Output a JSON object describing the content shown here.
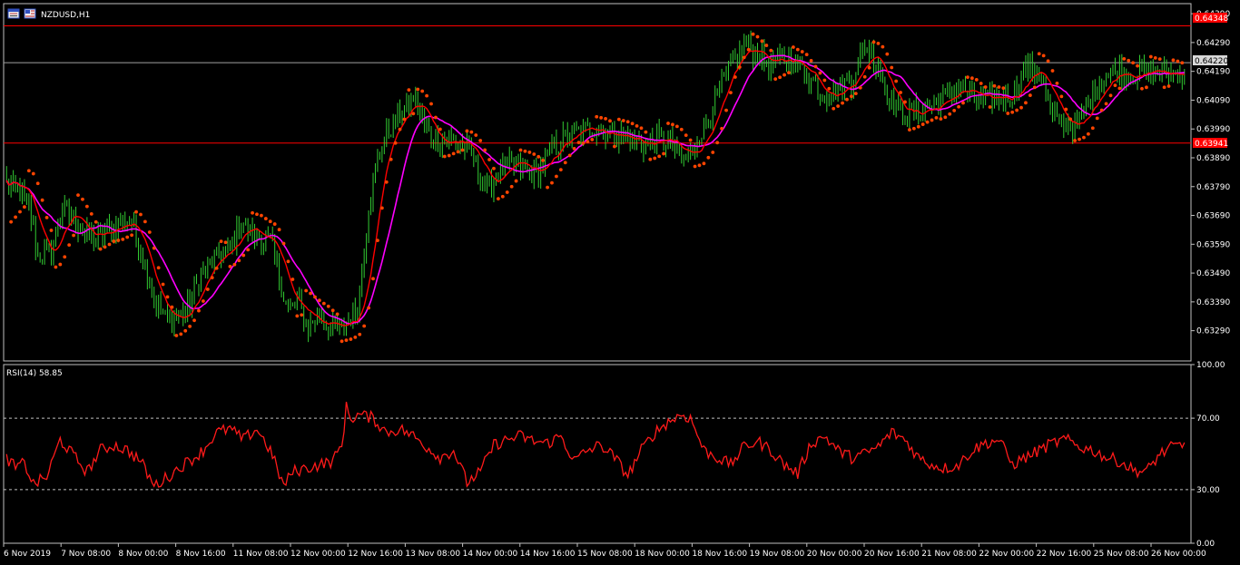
{
  "window": {
    "symbol_title": "NZDUSD,H1"
  },
  "colors": {
    "background": "#000000",
    "frame": "#c0c0c0",
    "candles": "#32cd32",
    "ma_fast": "#ff0000",
    "ma_slow": "#ff00ff",
    "sar": "#ff4500",
    "level_line": "#ff0000",
    "current_price_line": "#a0a0a0",
    "rsi_line": "#ff1a1a",
    "rsi_levels": "#c0c0c0"
  },
  "price_tags": {
    "top_level": "0.64348",
    "current": "0.64220",
    "bottom_level": "0.63941"
  },
  "rsi_panel": {
    "label": "RSI(14) 58.85",
    "levels": [
      "100.00",
      "70.00",
      "30.00",
      "0.00"
    ]
  },
  "chart_data": [
    {
      "type": "candlestick",
      "title": "NZDUSD,H1",
      "y_ticks": [
        "0.64390",
        "0.64290",
        "0.64190",
        "0.64090",
        "0.63990",
        "0.63890",
        "0.63790",
        "0.63690",
        "0.63590",
        "0.63490",
        "0.63390",
        "0.63290"
      ],
      "ylim": [
        0.63185,
        0.64425
      ],
      "x_ticks": [
        "6 Nov 2019",
        "7 Nov 08:00",
        "8 Nov 00:00",
        "8 Nov 16:00",
        "11 Nov 08:00",
        "12 Nov 00:00",
        "12 Nov 16:00",
        "13 Nov 08:00",
        "14 Nov 00:00",
        "14 Nov 16:00",
        "15 Nov 08:00",
        "18 Nov 00:00",
        "18 Nov 16:00",
        "19 Nov 08:00",
        "20 Nov 00:00",
        "20 Nov 16:00",
        "21 Nov 08:00",
        "22 Nov 00:00",
        "22 Nov 16:00",
        "25 Nov 08:00",
        "26 Nov 00:00"
      ],
      "horizontal_levels": [
        0.64348,
        0.63941
      ],
      "current_price": 0.6422,
      "close_path": {
        "x_index": [
          0,
          5,
          10,
          14,
          20,
          25,
          30,
          35,
          40,
          48,
          55,
          60,
          66,
          72,
          80,
          88,
          95,
          100,
          105,
          110,
          118,
          126,
          130,
          135,
          140,
          144,
          150,
          157,
          162,
          168,
          175,
          182,
          190,
          197,
          202,
          208,
          215,
          222,
          228,
          233,
          238,
          244,
          250,
          256,
          262,
          268,
          274,
          280,
          286,
          292,
          298,
          302,
          306,
          312,
          318,
          324,
          330,
          336,
          342,
          348,
          354,
          360,
          366,
          372,
          378,
          384,
          390,
          396,
          402,
          408,
          414,
          420,
          426,
          432,
          438,
          444,
          450,
          456,
          462,
          468,
          474,
          480,
          486,
          492,
          498,
          504,
          510,
          516,
          522,
          527
        ],
        "close": [
          0.638,
          0.6378,
          0.6372,
          0.6355,
          0.6356,
          0.6372,
          0.6368,
          0.6362,
          0.6361,
          0.6365,
          0.6368,
          0.6357,
          0.634,
          0.6332,
          0.6335,
          0.635,
          0.6355,
          0.6357,
          0.6368,
          0.6362,
          0.636,
          0.6335,
          0.634,
          0.633,
          0.6335,
          0.633,
          0.633,
          0.6336,
          0.6372,
          0.6395,
          0.6403,
          0.641,
          0.6395,
          0.6395,
          0.6395,
          0.639,
          0.6378,
          0.6386,
          0.6386,
          0.6384,
          0.6384,
          0.6392,
          0.6396,
          0.6398,
          0.64,
          0.6398,
          0.6397,
          0.6395,
          0.6393,
          0.6396,
          0.6393,
          0.6388,
          0.639,
          0.64,
          0.641,
          0.6421,
          0.6428,
          0.6425,
          0.6421,
          0.6423,
          0.6422,
          0.6416,
          0.6411,
          0.6413,
          0.6416,
          0.6428,
          0.6421,
          0.6408,
          0.6404,
          0.6405,
          0.6407,
          0.6409,
          0.6414,
          0.641,
          0.6408,
          0.641,
          0.6411,
          0.642,
          0.6419,
          0.6403,
          0.6401,
          0.64,
          0.6412,
          0.6418,
          0.6419,
          0.6418,
          0.6419,
          0.6418,
          0.6418,
          0.6419
        ]
      }
    },
    {
      "type": "line",
      "title": "RSI(14) 58.85",
      "ylim": [
        0,
        100
      ],
      "y_ticks": [
        "100.00",
        "70.00",
        "30.00",
        "0.00"
      ],
      "levels": [
        70,
        30
      ],
      "series": [
        {
          "name": "RSI(14)",
          "x_index": [
            0,
            4,
            8,
            12,
            18,
            24,
            30,
            36,
            42,
            48,
            54,
            60,
            66,
            72,
            78,
            84,
            88,
            94,
            100,
            106,
            112,
            118,
            124,
            128,
            134,
            140,
            146,
            150,
            152,
            154,
            158,
            164,
            170,
            176,
            182,
            188,
            194,
            200,
            206,
            212,
            218,
            224,
            230,
            236,
            242,
            248,
            254,
            260,
            266,
            272,
            278,
            284,
            290,
            296,
            302,
            306,
            312,
            318,
            324,
            330,
            336,
            342,
            348,
            354,
            360,
            366,
            372,
            378,
            384,
            390,
            396,
            402,
            408,
            414,
            420,
            426,
            432,
            438,
            444,
            450,
            456,
            462,
            468,
            474,
            480,
            486,
            492,
            498,
            504,
            510,
            516,
            522,
            527
          ],
          "values": [
            48,
            42,
            45,
            33,
            37,
            58,
            49,
            40,
            52,
            55,
            52,
            46,
            32,
            37,
            43,
            48,
            52,
            62,
            64,
            58,
            64,
            52,
            32,
            40,
            42,
            44,
            46,
            55,
            76,
            70,
            72,
            70,
            62,
            64,
            60,
            54,
            48,
            52,
            34,
            40,
            55,
            58,
            60,
            57,
            56,
            60,
            46,
            52,
            55,
            48,
            38,
            52,
            62,
            68,
            72,
            70,
            52,
            48,
            44,
            54,
            57,
            52,
            44,
            39,
            56,
            60,
            52,
            48,
            50,
            54,
            62,
            58,
            48,
            44,
            42,
            44,
            52,
            56,
            58,
            44,
            48,
            52,
            56,
            58,
            54,
            52,
            48,
            46,
            41,
            40,
            50,
            54,
            55
          ]
        }
      ]
    }
  ]
}
